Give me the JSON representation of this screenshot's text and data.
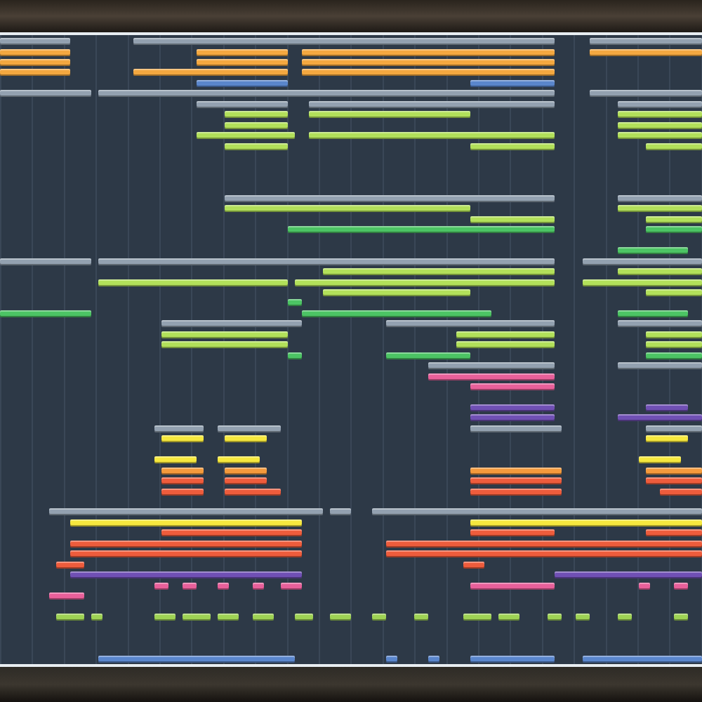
{
  "playlist": {
    "tracks": [
      {
        "kind": "clips",
        "clips": [
          {
            "color": "#93a1b0"
          },
          {
            "color": "#93a1b0"
          },
          {
            "color": "#93a1b0"
          }
        ]
      },
      {
        "kind": "clips",
        "clips": [
          {
            "color": "#f4a840"
          },
          {
            "color": "#f4a840"
          },
          {
            "color": "#f4a840"
          },
          {
            "color": "#f4a840"
          }
        ]
      },
      {
        "kind": "clips",
        "clips": [
          {
            "color": "#f4a840"
          },
          {
            "color": "#f4a840"
          },
          {
            "color": "#f4a840"
          }
        ]
      },
      {
        "kind": "clips",
        "clips": [
          {
            "color": "#f4a840"
          },
          {
            "color": "#f4a840"
          },
          {
            "color": "#f4a840"
          }
        ]
      },
      {
        "kind": "clips",
        "clips": [
          {
            "color": "#5a86cc"
          },
          {
            "color": "#5a86cc"
          }
        ]
      },
      {
        "kind": "clips",
        "clips": [
          {
            "color": "#93a1b0"
          },
          {
            "color": "#93a1b0"
          },
          {
            "color": "#93a1b0"
          }
        ]
      },
      {
        "kind": "clips",
        "clips": [
          {
            "color": "#93a1b0"
          },
          {
            "color": "#93a1b0"
          },
          {
            "color": "#93a1b0"
          }
        ]
      },
      {
        "kind": "clips",
        "clips": [
          {
            "color": "#b2e05a"
          },
          {
            "color": "#b2e05a"
          },
          {
            "color": "#b2e05a"
          }
        ]
      },
      {
        "kind": "clips",
        "clips": [
          {
            "color": "#b2e05a"
          },
          {
            "color": "#b2e05a"
          }
        ]
      },
      {
        "kind": "clips",
        "clips": [
          {
            "color": "#b2e05a"
          },
          {
            "color": "#b2e05a"
          },
          {
            "color": "#b2e05a"
          }
        ]
      },
      {
        "kind": "clips",
        "clips": [
          {
            "color": "#b2e05a"
          },
          {
            "color": "#b2e05a"
          },
          {
            "color": "#b2e05a"
          }
        ]
      },
      {
        "kind": "empty"
      },
      {
        "kind": "empty"
      },
      {
        "kind": "empty"
      },
      {
        "kind": "empty"
      },
      {
        "kind": "clips",
        "clips": [
          {
            "color": "#93a1b0"
          },
          {
            "color": "#93a1b0"
          }
        ]
      },
      {
        "kind": "clips",
        "clips": [
          {
            "color": "#b2e05a"
          },
          {
            "color": "#b2e05a"
          }
        ]
      },
      {
        "kind": "clips",
        "clips": [
          {
            "color": "#b2e05a"
          },
          {
            "color": "#b2e05a"
          }
        ]
      },
      {
        "kind": "clips",
        "clips": [
          {
            "color": "#4cc464"
          },
          {
            "color": "#4cc464"
          }
        ]
      },
      {
        "kind": "empty"
      },
      {
        "kind": "clips",
        "clips": [
          {
            "color": "#4cc464"
          }
        ]
      },
      {
        "kind": "clips",
        "clips": [
          {
            "color": "#93a1b0"
          },
          {
            "color": "#93a1b0"
          },
          {
            "color": "#93a1b0"
          }
        ]
      },
      {
        "kind": "clips",
        "clips": [
          {
            "color": "#b2e05a"
          },
          {
            "color": "#b2e05a"
          }
        ]
      },
      {
        "kind": "clips",
        "clips": [
          {
            "color": "#b2e05a"
          },
          {
            "color": "#b2e05a"
          },
          {
            "color": "#b2e05a"
          }
        ]
      },
      {
        "kind": "clips",
        "clips": [
          {
            "color": "#b2e05a"
          },
          {
            "color": "#b2e05a"
          }
        ]
      },
      {
        "kind": "clips",
        "clips": [
          {
            "color": "#4cc464"
          }
        ]
      },
      {
        "kind": "clips",
        "clips": [
          {
            "color": "#4cc464"
          },
          {
            "color": "#4cc464"
          },
          {
            "color": "#4cc464"
          }
        ]
      },
      {
        "kind": "clips",
        "clips": [
          {
            "color": "#93a1b0"
          },
          {
            "color": "#93a1b0"
          },
          {
            "color": "#93a1b0"
          }
        ]
      },
      {
        "kind": "clips",
        "clips": [
          {
            "color": "#b2e05a"
          },
          {
            "color": "#b2e05a"
          },
          {
            "color": "#b2e05a"
          }
        ]
      },
      {
        "kind": "clips",
        "clips": [
          {
            "color": "#b2e05a"
          },
          {
            "color": "#b2e05a"
          },
          {
            "color": "#b2e05a"
          }
        ]
      },
      {
        "kind": "clips",
        "clips": [
          {
            "color": "#4cc464"
          },
          {
            "color": "#4cc464"
          },
          {
            "color": "#4cc464"
          }
        ]
      },
      {
        "kind": "clips",
        "clips": [
          {
            "color": "#93a1b0"
          },
          {
            "color": "#93a1b0"
          }
        ]
      },
      {
        "kind": "clips",
        "clips": [
          {
            "color": "#e8609a"
          }
        ]
      },
      {
        "kind": "clips",
        "clips": [
          {
            "color": "#e8609a"
          }
        ]
      },
      {
        "kind": "empty"
      },
      {
        "kind": "clips",
        "clips": [
          {
            "color": "#7050b4"
          },
          {
            "color": "#7050b4"
          }
        ]
      },
      {
        "kind": "clips",
        "clips": [
          {
            "color": "#7050b4"
          },
          {
            "color": "#7050b4"
          }
        ]
      },
      {
        "kind": "clips",
        "clips": [
          {
            "color": "#93a1b0"
          },
          {
            "color": "#93a1b0"
          },
          {
            "color": "#93a1b0"
          },
          {
            "color": "#93a1b0"
          }
        ]
      },
      {
        "kind": "clips",
        "clips": [
          {
            "color": "#f6e83e"
          },
          {
            "color": "#f6e83e"
          },
          {
            "color": "#f6e83e"
          }
        ]
      },
      {
        "kind": "empty"
      },
      {
        "kind": "clips",
        "clips": [
          {
            "color": "#f6e83e"
          },
          {
            "color": "#f6e83e"
          },
          {
            "color": "#f6e83e"
          }
        ]
      },
      {
        "kind": "clips",
        "clips": [
          {
            "color": "#f49a3c"
          },
          {
            "color": "#f49a3c"
          },
          {
            "color": "#f49a3c"
          },
          {
            "color": "#f49a3c"
          }
        ]
      },
      {
        "kind": "clips",
        "clips": [
          {
            "color": "#ee5c3c"
          },
          {
            "color": "#ee5c3c"
          },
          {
            "color": "#ee5c3c"
          },
          {
            "color": "#ee5c3c"
          }
        ]
      },
      {
        "kind": "clips",
        "clips": [
          {
            "color": "#ee5c3c"
          },
          {
            "color": "#ee5c3c"
          },
          {
            "color": "#ee5c3c"
          },
          {
            "color": "#ee5c3c"
          }
        ]
      },
      {
        "kind": "empty"
      },
      {
        "kind": "clips",
        "clips": [
          {
            "color": "#93a1b0"
          },
          {
            "color": "#93a1b0"
          },
          {
            "color": "#93a1b0"
          }
        ]
      },
      {
        "kind": "clips",
        "clips": [
          {
            "color": "#f6e83e"
          },
          {
            "color": "#f6e83e"
          }
        ]
      },
      {
        "kind": "clips",
        "clips": [
          {
            "color": "#ee5c3c"
          },
          {
            "color": "#ee5c3c"
          },
          {
            "color": "#ee5c3c"
          }
        ]
      },
      {
        "kind": "clips",
        "clips": [
          {
            "color": "#ee5c3c"
          },
          {
            "color": "#ee5c3c"
          }
        ]
      },
      {
        "kind": "clips",
        "clips": [
          {
            "color": "#ee5c3c"
          },
          {
            "color": "#ee5c3c"
          }
        ]
      },
      {
        "kind": "clips",
        "clips": [
          {
            "color": "#ee5c3c"
          },
          {
            "color": "#ee5c3c"
          }
        ]
      },
      {
        "kind": "clips",
        "clips": [
          {
            "color": "#7050b4"
          },
          {
            "color": "#7050b4"
          }
        ]
      },
      {
        "kind": "clips",
        "clips": [
          {
            "color": "#e8609a"
          },
          {
            "color": "#e8609a"
          },
          {
            "color": "#e8609a"
          },
          {
            "color": "#e8609a"
          },
          {
            "color": "#e8609a"
          },
          {
            "color": "#e8609a"
          },
          {
            "color": "#e8609a"
          },
          {
            "color": "#e8609a"
          }
        ]
      },
      {
        "kind": "clips",
        "clips": [
          {
            "color": "#e8609a"
          }
        ]
      },
      {
        "kind": "empty"
      },
      {
        "kind": "clips",
        "clips": [
          {
            "color": "#9ed254"
          },
          {
            "color": "#9ed254"
          },
          {
            "color": "#9ed254"
          },
          {
            "color": "#9ed254"
          },
          {
            "color": "#9ed254"
          },
          {
            "color": "#9ed254"
          },
          {
            "color": "#9ed254"
          },
          {
            "color": "#9ed254"
          },
          {
            "color": "#9ed254"
          },
          {
            "color": "#9ed254"
          },
          {
            "color": "#9ed254"
          },
          {
            "color": "#9ed254"
          },
          {
            "color": "#9ed254"
          },
          {
            "color": "#9ed254"
          },
          {
            "color": "#9ed254"
          },
          {
            "color": "#9ed254"
          }
        ]
      },
      {
        "kind": "empty"
      },
      {
        "kind": "empty"
      },
      {
        "kind": "empty"
      },
      {
        "kind": "clips",
        "clips": [
          {
            "color": "#5a86cc"
          },
          {
            "color": "#5a86cc"
          },
          {
            "color": "#5a86cc"
          },
          {
            "color": "#5a86cc"
          },
          {
            "color": "#5a86cc"
          }
        ]
      }
    ]
  }
}
